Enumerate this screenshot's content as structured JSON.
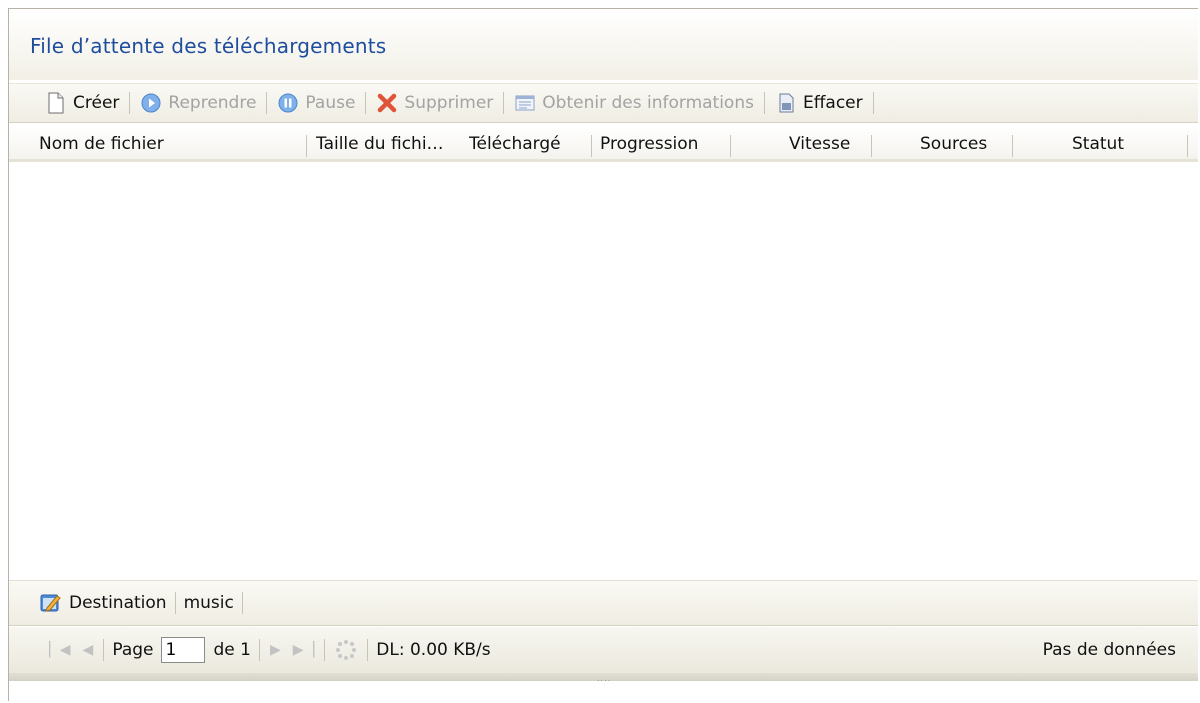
{
  "title": "File d’attente des téléchargements",
  "toolbar": {
    "create": "Créer",
    "resume": "Reprendre",
    "pause": "Pause",
    "delete": "Supprimer",
    "info": "Obtenir des informations",
    "clear": "Effacer"
  },
  "columns": {
    "filename": "Nom de fichier",
    "filesize": "Taille du fichi…",
    "downloaded": "Téléchargé",
    "progress": "Progression",
    "speed": "Vitesse",
    "sources": "Sources",
    "status": "Statut"
  },
  "bottom": {
    "destination_label": "Destination",
    "destination_value": "music"
  },
  "paging": {
    "page_label": "Page",
    "page_value": "1",
    "of_label": "de 1",
    "dl_speed": "DL: 0.00 KB/s",
    "no_data": "Pas de données"
  },
  "colors": {
    "title": "#1f4d9e",
    "delete_red": "#d9371e",
    "resume_blue": "#3b82d6"
  },
  "icons": [
    "new-file-icon",
    "resume-icon",
    "pause-icon",
    "delete-icon",
    "info-icon",
    "clear-icon",
    "destination-edit-icon",
    "first-page-icon",
    "prev-page-icon",
    "next-page-icon",
    "last-page-icon",
    "refresh-icon"
  ]
}
